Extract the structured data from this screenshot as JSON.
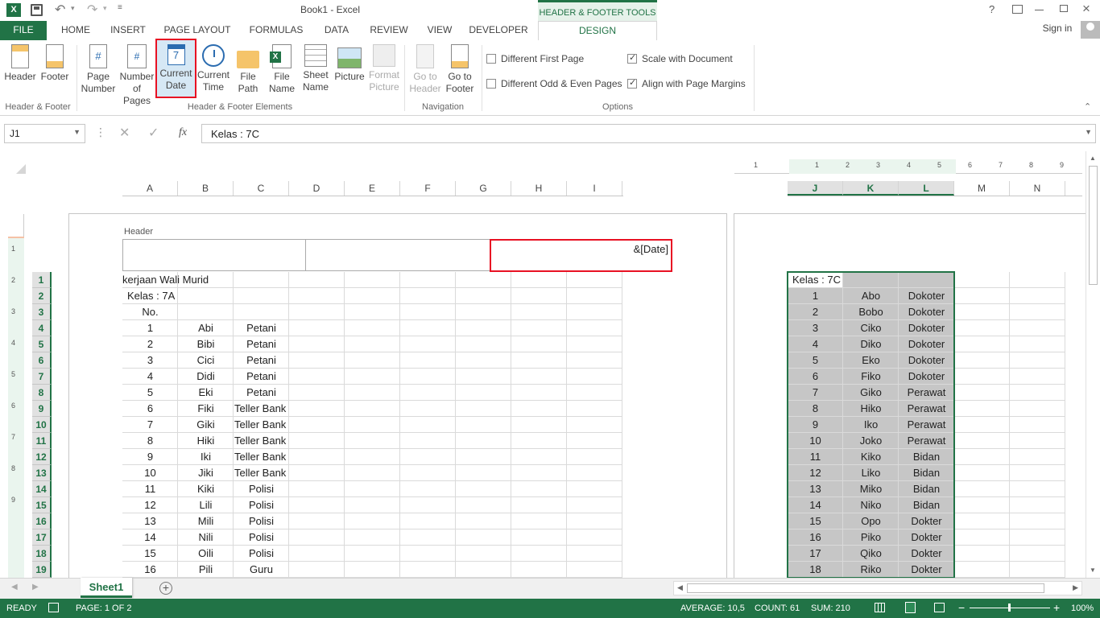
{
  "window": {
    "title": "Book1 - Excel",
    "context_tab_title": "HEADER & FOOTER TOOLS",
    "sign_in": "Sign in",
    "help": "?"
  },
  "tabs": [
    "FILE",
    "HOME",
    "INSERT",
    "PAGE LAYOUT",
    "FORMULAS",
    "DATA",
    "REVIEW",
    "VIEW",
    "DEVELOPER",
    "DESIGN"
  ],
  "ribbon": {
    "header": "Header",
    "footer": "Footer",
    "group_hf": "Header & Footer",
    "page_number": [
      "Page",
      "Number"
    ],
    "number_of_pages": [
      "Number",
      "of Pages"
    ],
    "current_date": [
      "Current",
      "Date"
    ],
    "current_time": [
      "Current",
      "Time"
    ],
    "file_path": [
      "File",
      "Path"
    ],
    "file_name": [
      "File",
      "Name"
    ],
    "sheet_name": [
      "Sheet",
      "Name"
    ],
    "picture": "Picture",
    "format_picture": [
      "Format",
      "Picture"
    ],
    "group_elements": "Header & Footer Elements",
    "go_to_header": [
      "Go to",
      "Header"
    ],
    "go_to_footer": [
      "Go to",
      "Footer"
    ],
    "group_nav": "Navigation",
    "different_first_page": "Different First Page",
    "different_odd_even": "Different Odd & Even Pages",
    "scale_with_document": "Scale with Document",
    "align_with_margins": "Align with Page Margins",
    "group_options": "Options"
  },
  "formula_bar": {
    "name_box": "J1",
    "fx": "fx",
    "content": "Kelas : 7C"
  },
  "sheet": {
    "columns_left": [
      "A",
      "B",
      "C",
      "D",
      "E",
      "F",
      "G",
      "H",
      "I"
    ],
    "columns_right": [
      "J",
      "K",
      "L",
      "M",
      "N"
    ],
    "header_label": "Header",
    "header_right_field": "&[Date]",
    "row_numbers": [
      "1",
      "2",
      "3",
      "4",
      "5",
      "6",
      "7",
      "8",
      "9",
      "10",
      "11",
      "12",
      "13",
      "14",
      "15",
      "16",
      "17",
      "18",
      "19"
    ],
    "ruler_left": [
      "1",
      "2",
      "3",
      "4",
      "5",
      "6",
      "7",
      "8",
      "9"
    ],
    "ruler_top": [
      "1",
      "1",
      "2",
      "3",
      "4",
      "5",
      "6",
      "7",
      "8",
      "9"
    ],
    "left_rows": [
      [
        "kerjaan Wali Murid",
        "",
        ""
      ],
      [
        "Kelas : 7A",
        "",
        ""
      ],
      [
        "No.",
        "",
        ""
      ],
      [
        "1",
        "Abi",
        "Petani"
      ],
      [
        "2",
        "Bibi",
        "Petani"
      ],
      [
        "3",
        "Cici",
        "Petani"
      ],
      [
        "4",
        "Didi",
        "Petani"
      ],
      [
        "5",
        "Eki",
        "Petani"
      ],
      [
        "6",
        "Fiki",
        "Teller Bank"
      ],
      [
        "7",
        "Giki",
        "Teller Bank"
      ],
      [
        "8",
        "Hiki",
        "Teller Bank"
      ],
      [
        "9",
        "Iki",
        "Teller Bank"
      ],
      [
        "10",
        "Jiki",
        "Teller Bank"
      ],
      [
        "11",
        "Kiki",
        "Polisi"
      ],
      [
        "12",
        "Lili",
        "Polisi"
      ],
      [
        "13",
        "Mili",
        "Polisi"
      ],
      [
        "14",
        "Nili",
        "Polisi"
      ],
      [
        "15",
        "Oili",
        "Polisi"
      ],
      [
        "16",
        "Pili",
        "Guru"
      ]
    ],
    "right_rows": [
      [
        "Kelas : 7C",
        "",
        ""
      ],
      [
        "1",
        "Abo",
        "Dokoter"
      ],
      [
        "2",
        "Bobo",
        "Dokoter"
      ],
      [
        "3",
        "Ciko",
        "Dokoter"
      ],
      [
        "4",
        "Diko",
        "Dokoter"
      ],
      [
        "5",
        "Eko",
        "Dokoter"
      ],
      [
        "6",
        "Fiko",
        "Dokoter"
      ],
      [
        "7",
        "Giko",
        "Perawat"
      ],
      [
        "8",
        "Hiko",
        "Perawat"
      ],
      [
        "9",
        "Iko",
        "Perawat"
      ],
      [
        "10",
        "Joko",
        "Perawat"
      ],
      [
        "11",
        "Kiko",
        "Bidan"
      ],
      [
        "12",
        "Liko",
        "Bidan"
      ],
      [
        "13",
        "Miko",
        "Bidan"
      ],
      [
        "14",
        "Niko",
        "Bidan"
      ],
      [
        "15",
        "Opo",
        "Dokter"
      ],
      [
        "16",
        "Piko",
        "Dokter"
      ],
      [
        "17",
        "Qiko",
        "Dokter"
      ],
      [
        "18",
        "Riko",
        "Dokter"
      ]
    ]
  },
  "sheet_tab": "Sheet1",
  "status": {
    "ready": "READY",
    "page": "PAGE: 1 OF 2",
    "average": "AVERAGE: 10,5",
    "count": "COUNT: 61",
    "sum": "SUM: 210",
    "zoom": "100%"
  },
  "colors": {
    "excel_green": "#217346",
    "highlight_red": "#e81123",
    "selection_gray": "#c6c6c6"
  }
}
